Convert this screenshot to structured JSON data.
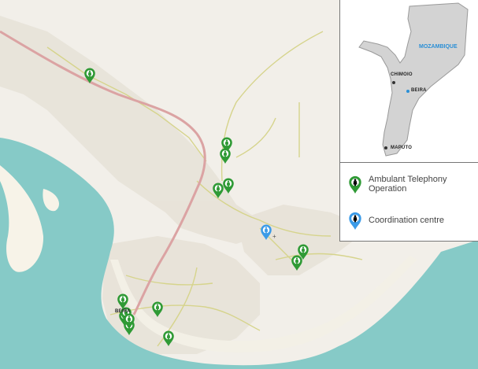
{
  "map": {
    "base_colors": {
      "sea": "#86cac7",
      "land": "#f2efe9",
      "urban": "#e7e2d8",
      "main_road": "#dba3a3",
      "minor_road": "#d6d48c"
    },
    "city_label": "BEIRA",
    "markers": {
      "ambulant_telephony": {
        "count": 14,
        "color": "#2f9a35",
        "icon": "person-pin-icon"
      },
      "coordination_centre": {
        "count": 1,
        "color": "#3b9be8",
        "icon": "person-pin-icon"
      }
    }
  },
  "inset": {
    "country": "MOZAMBIQUE",
    "cities": [
      "CHIMOIO",
      "BEIRA",
      "MAPUTO"
    ],
    "colors": {
      "country_fill": "#d3d3d3",
      "country_stroke": "#999999",
      "beira_dot": "#2a8fd6",
      "city_dot": "#333333"
    }
  },
  "legend": {
    "items": [
      {
        "label": "Ambulant Telephony Operation",
        "color": "#2f9a35",
        "icon": "green-marker-icon"
      },
      {
        "label": "Coordination centre",
        "color": "#3b9be8",
        "icon": "blue-marker-icon"
      }
    ]
  }
}
